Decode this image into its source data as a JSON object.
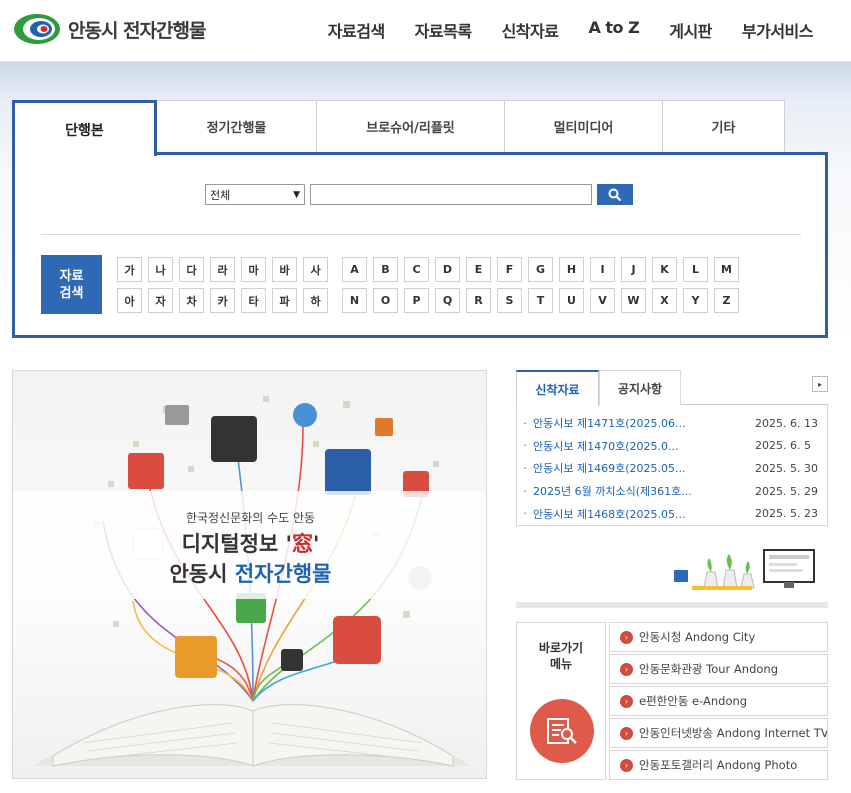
{
  "header": {
    "site_title": "안동시 전자간행물",
    "nav": [
      "자료검색",
      "자료목록",
      "신착자료",
      "A to Z",
      "게시판",
      "부가서비스"
    ]
  },
  "search": {
    "tabs": [
      "단행본",
      "정기간행물",
      "브로슈어/리플릿",
      "멀티미디어",
      "기타"
    ],
    "select_value": "전체",
    "query_value": "",
    "jump_label_line1": "자료",
    "jump_label_line2": "검색",
    "korean_keys": [
      "가",
      "나",
      "다",
      "라",
      "마",
      "바",
      "사",
      "아",
      "자",
      "차",
      "카",
      "타",
      "파",
      "하"
    ],
    "english_keys": [
      "A",
      "B",
      "C",
      "D",
      "E",
      "F",
      "G",
      "H",
      "I",
      "J",
      "K",
      "L",
      "M",
      "N",
      "O",
      "P",
      "Q",
      "R",
      "S",
      "T",
      "U",
      "V",
      "W",
      "X",
      "Y",
      "Z"
    ]
  },
  "banner": {
    "subtitle": "한국정신문화의 수도 안동",
    "line1_prefix": "디지털정보 '",
    "line1_highlight": "窓",
    "line1_suffix": "'",
    "line2_prefix": "안동시 ",
    "line2_highlight": "전자간행물"
  },
  "news": {
    "tabs": [
      "신착자료",
      "공지사항"
    ],
    "more_symbol": "▸",
    "items": [
      {
        "title": "안동시보 제1471호(2025.06...",
        "date": "2025. 6. 13"
      },
      {
        "title": "안동시보 제1470호(2025.0...",
        "date": "2025. 6. 5"
      },
      {
        "title": "안동시보 제1469호(2025.05...",
        "date": "2025. 5. 30"
      },
      {
        "title": "2025년 6월 까치소식(제361호...",
        "date": "2025. 5. 29"
      },
      {
        "title": "안동시보 제1468호(2025.05...",
        "date": "2025. 5. 23"
      }
    ]
  },
  "quick": {
    "title_line1": "바로가기",
    "title_line2": "메뉴",
    "links": [
      "안동시청 Andong City",
      "안동문화관광 Tour Andong",
      "e편한안동 e-Andong",
      "안동인터넷방송 Andong Internet TV",
      "안동포토갤러리 Andong Photo"
    ]
  },
  "colors": {
    "primary_blue": "#2f5ea6",
    "accent_red": "#d4272e",
    "quick_red": "#e05a4a"
  }
}
